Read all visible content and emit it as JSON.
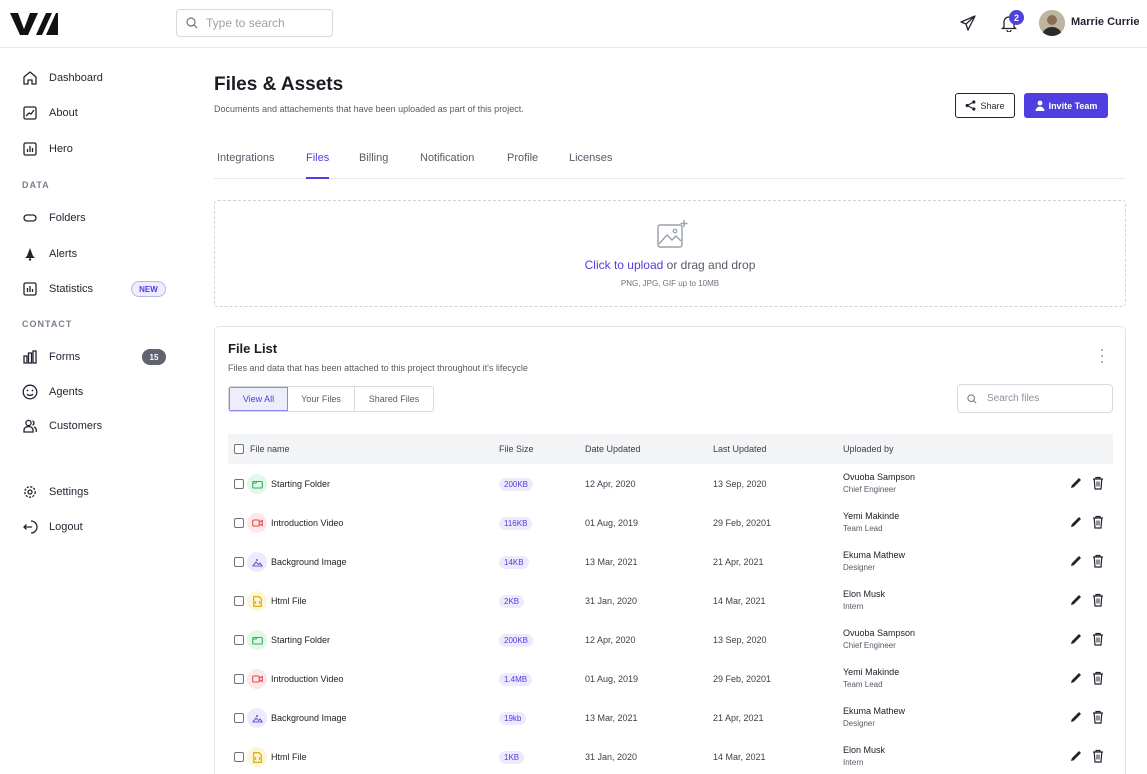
{
  "topbar": {
    "search_placeholder": "Type to search",
    "notification_count": "2",
    "user_name": "Marrie Currie"
  },
  "sidebar": {
    "items": [
      {
        "label": "Dashboard",
        "icon": "home-icon"
      },
      {
        "label": "About",
        "icon": "chart-line-icon"
      },
      {
        "label": "Hero",
        "icon": "bar-chart-icon"
      }
    ],
    "data_section": "DATA",
    "data_items": [
      {
        "label": "Folders",
        "icon": "folder-icon"
      },
      {
        "label": "Alerts",
        "icon": "bell-icon"
      },
      {
        "label": "Statistics",
        "icon": "statistics-icon",
        "badge": "NEW"
      }
    ],
    "contact_section": "CONTACT",
    "contact_items": [
      {
        "label": "Forms",
        "icon": "forms-icon",
        "badge": "15"
      },
      {
        "label": "Agents",
        "icon": "smile-icon"
      },
      {
        "label": "Customers",
        "icon": "users-icon"
      }
    ],
    "bottom_items": [
      {
        "label": "Settings",
        "icon": "gear-icon"
      },
      {
        "label": "Logout",
        "icon": "logout-icon"
      }
    ]
  },
  "header": {
    "title": "Files & Assets",
    "subtitle": "Documents and attachements that have been uploaded as part of this project.",
    "share_label": "Share",
    "invite_label": "Invite Team"
  },
  "tabs": [
    {
      "label": "Integrations"
    },
    {
      "label": "Files",
      "active": true
    },
    {
      "label": "Billing"
    },
    {
      "label": "Notification"
    },
    {
      "label": "Profile"
    },
    {
      "label": "Licenses"
    }
  ],
  "upload": {
    "link_text": "Click to upload",
    "rest_text": " or drag and drop",
    "hint": "PNG, JPG, GIF up to 10MB"
  },
  "file_list": {
    "title": "File List",
    "subtitle": "Files and data that has been attached to this project throughout it's lifecycle",
    "filters": [
      "View All",
      "Your Files",
      "Shared Files"
    ],
    "active_filter": "View All",
    "search_placeholder": "Search files",
    "columns": [
      "File name",
      "File Size",
      "Date Updated",
      "Last Updated",
      "Uploaded by"
    ],
    "rows": [
      {
        "name": "Starting Folder",
        "type": "folder",
        "size": "200KB",
        "date": "12 Apr, 2020",
        "last": "13 Sep, 2020",
        "by": "Ovuoba Sampson",
        "role": "Chief Engineer"
      },
      {
        "name": "Introduction Video",
        "type": "video",
        "size": "116KB",
        "date": "01 Aug, 2019",
        "last": "29 Feb, 20201",
        "by": "Yemi Makinde",
        "role": "Team Lead"
      },
      {
        "name": "Background Image",
        "type": "image",
        "size": "14KB",
        "date": "13 Mar, 2021",
        "last": "21 Apr, 2021",
        "by": "Ekuma Mathew",
        "role": "Designer"
      },
      {
        "name": "Html File",
        "type": "html",
        "size": "2KB",
        "date": "31 Jan, 2020",
        "last": "14 Mar, 2021",
        "by": "Elon Musk",
        "role": "Intern"
      },
      {
        "name": "Starting Folder",
        "type": "folder",
        "size": "200KB",
        "date": "12 Apr, 2020",
        "last": "13 Sep, 2020",
        "by": "Ovuoba Sampson",
        "role": "Chief Engineer"
      },
      {
        "name": "Introduction Video",
        "type": "video",
        "size": "1.4MB",
        "date": "01 Aug, 2019",
        "last": "29 Feb, 20201",
        "by": "Yemi Makinde",
        "role": "Team Lead"
      },
      {
        "name": "Background Image",
        "type": "image",
        "size": "19kb",
        "date": "13 Mar, 2021",
        "last": "21 Apr, 2021",
        "by": "Ekuma Mathew",
        "role": "Designer"
      },
      {
        "name": "Html File",
        "type": "html",
        "size": "1KB",
        "date": "31 Jan, 2020",
        "last": "14 Mar, 2021",
        "by": "Elon Musk",
        "role": "Intern"
      }
    ]
  },
  "colors": {
    "accent": "#4f3ee0",
    "folder": "#2db35c",
    "video": "#e5484d",
    "image": "#6e56cf",
    "html": "#d6a400"
  }
}
